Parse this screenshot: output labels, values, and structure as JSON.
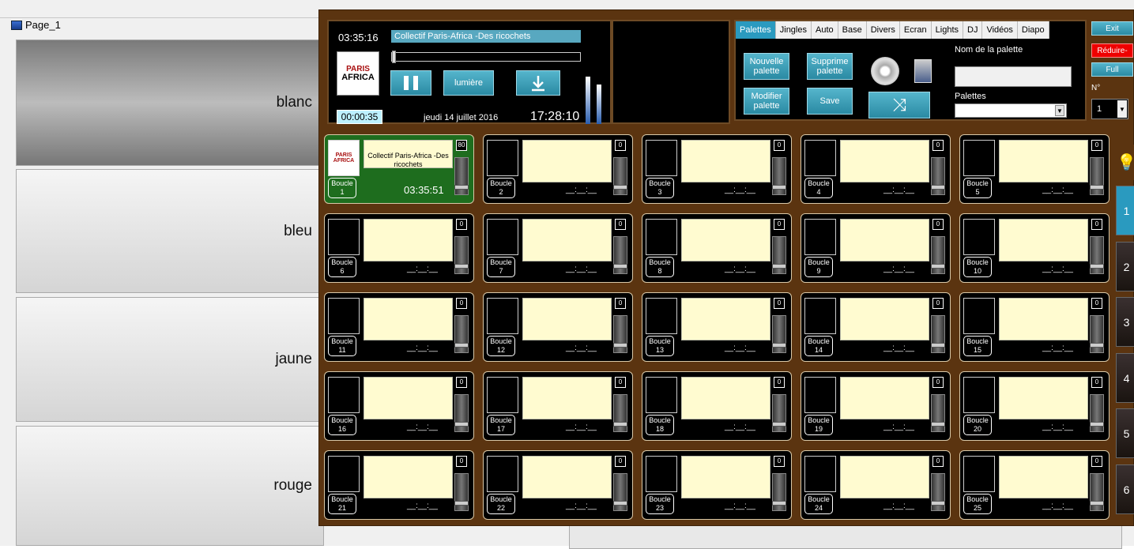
{
  "background": {
    "page_title": "Page_1",
    "buttons": [
      "blanc",
      "bleu",
      "jaune",
      "rouge"
    ]
  },
  "player": {
    "time_top": "03:35:16",
    "track_title": "Collectif Paris-Africa -Des ricochets",
    "lumiere_label": "lumière",
    "elapsed": "00:00:35",
    "date": "jeudi 14 juillet 2016",
    "clock": "17:28:10",
    "logo_line1": "PARIS",
    "logo_line2": "AFRICA"
  },
  "tabs": [
    "Palettes",
    "Jingles",
    "Auto",
    "Base",
    "Divers",
    "Ecran",
    "Lights",
    "DJ",
    "Vidéos",
    "Diapo"
  ],
  "palette": {
    "nouvelle": "Nouvelle palette",
    "supprime": "Supprime palette",
    "modifier": "Modifier palette",
    "save": "Save",
    "nom_label": "Nom de la palette",
    "palettes_label": "Palettes",
    "n_label": "N°",
    "n_value": "1"
  },
  "right_buttons": {
    "exit": "Exit",
    "reduire": "Réduire-",
    "full": "Full"
  },
  "slots": [
    {
      "label": "Boucle",
      "num": "1",
      "vol": "80",
      "title": "Collectif Paris-Africa -Des ricochets",
      "dur": "03:35:51"
    },
    {
      "label": "Boucle",
      "num": "2",
      "vol": "0",
      "dur": "__:__:__"
    },
    {
      "label": "Boucle",
      "num": "3",
      "vol": "0",
      "dur": "__:__:__"
    },
    {
      "label": "Boucle",
      "num": "4",
      "vol": "0",
      "dur": "__:__:__"
    },
    {
      "label": "Boucle",
      "num": "5",
      "vol": "0",
      "dur": "__:__:__"
    },
    {
      "label": "Boucle",
      "num": "6",
      "vol": "0",
      "dur": "__:__:__"
    },
    {
      "label": "Boucle",
      "num": "7",
      "vol": "0",
      "dur": "__:__:__"
    },
    {
      "label": "Boucle",
      "num": "8",
      "vol": "0",
      "dur": "__:__:__"
    },
    {
      "label": "Boucle",
      "num": "9",
      "vol": "0",
      "dur": "__:__:__"
    },
    {
      "label": "Boucle",
      "num": "10",
      "vol": "0",
      "dur": "__:__:__"
    },
    {
      "label": "Boucle",
      "num": "11",
      "vol": "0",
      "dur": "__:__:__"
    },
    {
      "label": "Boucle",
      "num": "12",
      "vol": "0",
      "dur": "__:__:__"
    },
    {
      "label": "Boucle",
      "num": "13",
      "vol": "0",
      "dur": "__:__:__"
    },
    {
      "label": "Boucle",
      "num": "14",
      "vol": "0",
      "dur": "__:__:__"
    },
    {
      "label": "Boucle",
      "num": "15",
      "vol": "0",
      "dur": "__:__:__"
    },
    {
      "label": "Boucle",
      "num": "16",
      "vol": "0",
      "dur": "__:__:__"
    },
    {
      "label": "Boucle",
      "num": "17",
      "vol": "0",
      "dur": "__:__:__"
    },
    {
      "label": "Boucle",
      "num": "18",
      "vol": "0",
      "dur": "__:__:__"
    },
    {
      "label": "Boucle",
      "num": "19",
      "vol": "0",
      "dur": "__:__:__"
    },
    {
      "label": "Boucle",
      "num": "20",
      "vol": "0",
      "dur": "__:__:__"
    },
    {
      "label": "Boucle",
      "num": "21",
      "vol": "0",
      "dur": "__:__:__"
    },
    {
      "label": "Boucle",
      "num": "22",
      "vol": "0",
      "dur": "__:__:__"
    },
    {
      "label": "Boucle",
      "num": "23",
      "vol": "0",
      "dur": "__:__:__"
    },
    {
      "label": "Boucle",
      "num": "24",
      "vol": "0",
      "dur": "__:__:__"
    },
    {
      "label": "Boucle",
      "num": "25",
      "vol": "0",
      "dur": "__:__:__"
    }
  ],
  "pages": [
    "1",
    "2",
    "3",
    "4",
    "5",
    "6"
  ],
  "colors": {
    "accent": "#2a9abf",
    "panel": "#5b3410",
    "active_slot": "#1e6d1e",
    "reduire": "#e00000"
  },
  "icons": {
    "bulb": "lightbulb-icon",
    "shuffle": "shuffle-icon",
    "download": "download-icon",
    "pause": "pause-icon",
    "disc": "cd-icon",
    "camera": "camera-icon"
  }
}
